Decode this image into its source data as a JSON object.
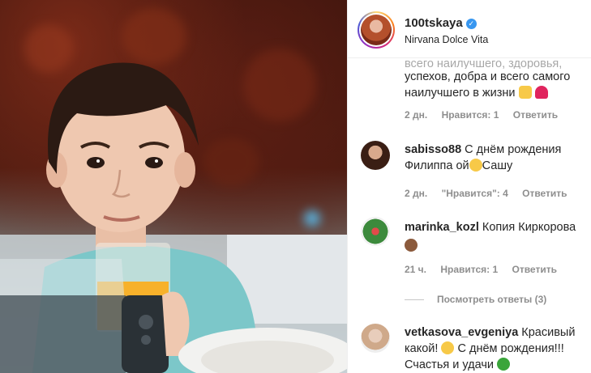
{
  "post": {
    "photo_alt": "",
    "account": {
      "username": "100tskaya",
      "subtitle": "Nirvana Dolce Vita",
      "verified": true
    },
    "accent_color": "#3897f0"
  },
  "comments": [
    {
      "partial": true,
      "text_line0": "всего наилучшего, здоровья,",
      "text_line1": "успехов, добра и всего самого",
      "text_line2": "наилучшего в жизни",
      "emoji": [
        "praise-hands-icon",
        "heart-icon"
      ],
      "time": "2 дн.",
      "likes": "Нравится: 1",
      "reply": "Ответить"
    },
    {
      "username": "sabisso88",
      "text_part1": "С днём рождения",
      "text_part2": "Филиппа ой",
      "text_part3": "Сашу",
      "emoji": [
        "grimace-face-icon"
      ],
      "time": "2 дн.",
      "likes": "\"Нравится\": 4",
      "reply": "Ответить"
    },
    {
      "username": "marinka_kozl",
      "text": "Копия Киркорова",
      "emoji": [
        "monkey-face-icon"
      ],
      "time": "21 ч.",
      "likes": "Нравится: 1",
      "reply": "Ответить",
      "view_replies": "Посмотреть ответы (3)"
    },
    {
      "username": "vetkasova_evgeniya",
      "text_part1": "Красивый",
      "text_part2": "какой!",
      "text_part3": "С днём рождения!!!",
      "text_part4": "Счастья и удачи",
      "emoji": [
        "heart-eyes-face-icon",
        "four-leaf-clover-icon"
      ]
    }
  ]
}
